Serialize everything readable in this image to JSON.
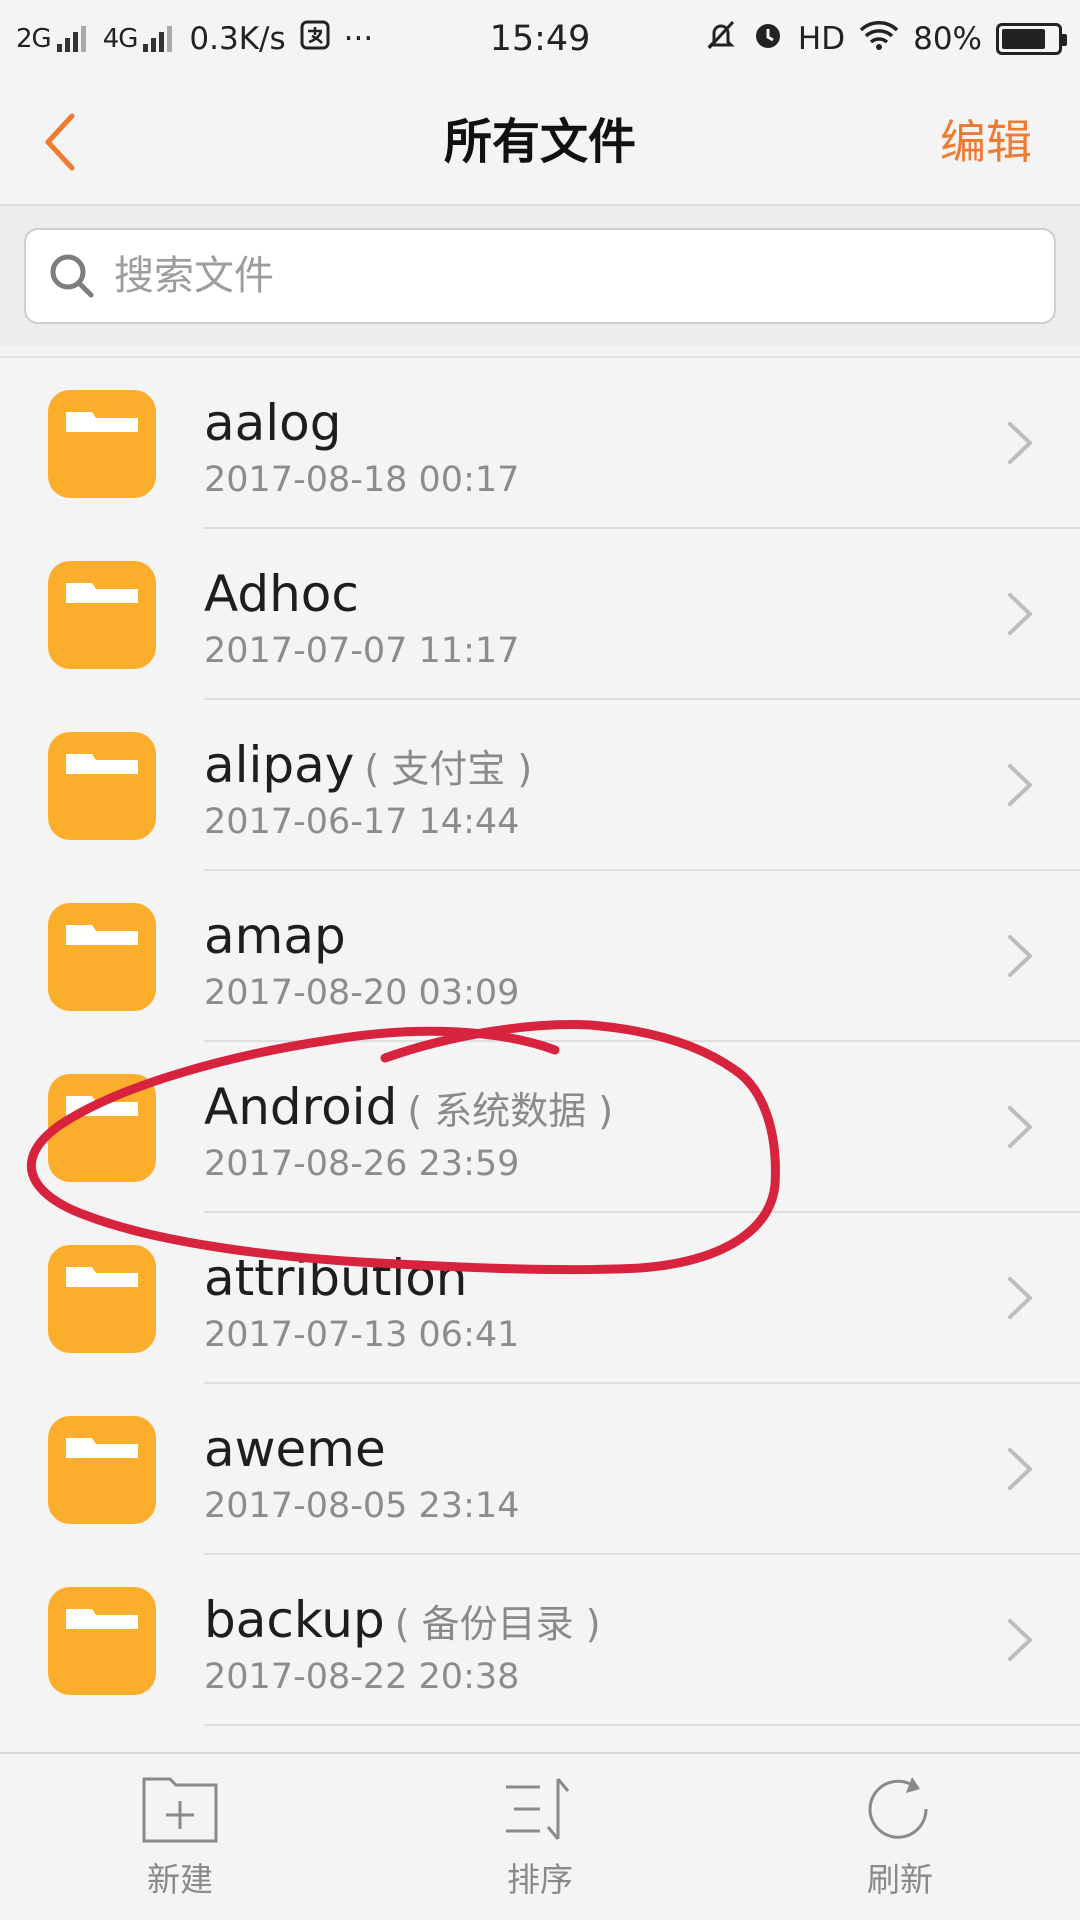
{
  "status_bar": {
    "network1": "2G",
    "network2": "4G",
    "speed": "0.3K/s",
    "more": "···",
    "time": "15:49",
    "hd": "HD",
    "battery": "80%",
    "battery_level": 0.8
  },
  "nav": {
    "title": "所有文件",
    "edit_label": "编辑"
  },
  "search": {
    "placeholder": "搜索文件",
    "value": ""
  },
  "files": [
    {
      "name": "aalog",
      "tag": "",
      "date": "2017-08-18 00:17"
    },
    {
      "name": "Adhoc",
      "tag": "",
      "date": "2017-07-07 11:17"
    },
    {
      "name": "alipay",
      "tag": "( 支付宝 )",
      "date": "2017-06-17 14:44"
    },
    {
      "name": "amap",
      "tag": "",
      "date": "2017-08-20 03:09"
    },
    {
      "name": "Android",
      "tag": "( 系统数据 )",
      "date": "2017-08-26 23:59"
    },
    {
      "name": "attribution",
      "tag": "",
      "date": "2017-07-13 06:41"
    },
    {
      "name": "aweme",
      "tag": "",
      "date": "2017-08-05 23:14"
    },
    {
      "name": "backup",
      "tag": "( 备份目录 )",
      "date": "2017-08-22 20:38"
    }
  ],
  "toolbar": {
    "new_label": "新建",
    "sort_label": "排序",
    "refresh_label": "刷新"
  },
  "colors": {
    "accent": "#ef7a32",
    "folder": "#fbad2c",
    "annotation": "#d8233f"
  },
  "icons": {
    "back": "chevron-left-icon",
    "search": "search-icon",
    "folder": "folder-icon",
    "row_arrow": "chevron-right-icon",
    "new": "new-folder-icon",
    "sort": "sort-icon",
    "refresh": "refresh-icon"
  }
}
